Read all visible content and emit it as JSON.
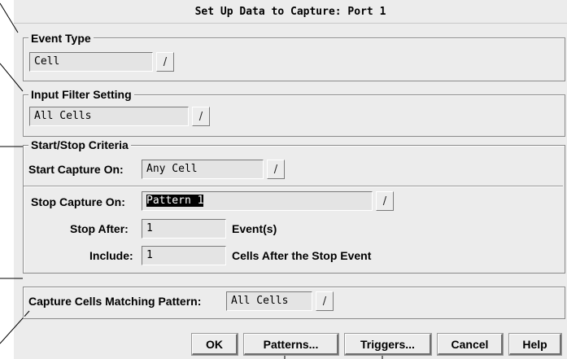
{
  "window": {
    "title": "Set Up Data to Capture: Port 1"
  },
  "event_type": {
    "legend": "Event Type",
    "value": "Cell"
  },
  "input_filter": {
    "legend": "Input Filter Setting",
    "value": "All Cells"
  },
  "start_stop": {
    "legend": "Start/Stop Criteria",
    "start_label": "Start Capture On:",
    "start_value": "Any Cell",
    "stop_label": "Stop Capture On:",
    "stop_value": "Pattern 1",
    "stop_after_label": "Stop After:",
    "stop_after_value": "1",
    "stop_after_unit": "Event(s)",
    "include_label": "Include:",
    "include_value": "1",
    "include_unit": "Cells After the Stop Event"
  },
  "capture_pattern": {
    "label": "Capture Cells Matching Pattern:",
    "value": "All Cells"
  },
  "buttons": {
    "ok": "OK",
    "patterns": "Patterns...",
    "triggers": "Triggers...",
    "cancel": "Cancel",
    "help": "Help"
  },
  "combo_glyph": "/"
}
